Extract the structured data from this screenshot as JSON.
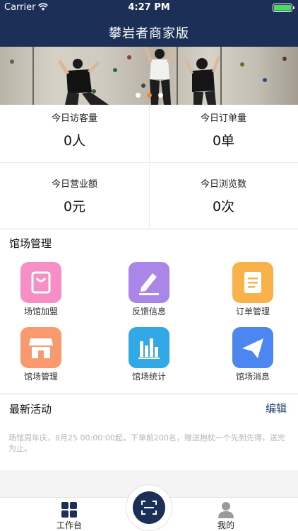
{
  "status_bar": {
    "carrier": "Carrier",
    "time": "4:27 PM"
  },
  "nav": {
    "title": "攀岩者商家版"
  },
  "banner": {
    "page_count": 3,
    "active_page": 2
  },
  "stats": {
    "visitors_label": "今日访客量",
    "visitors_value": "0人",
    "orders_label": "今日订单量",
    "orders_value": "0单",
    "revenue_label": "今日营业额",
    "revenue_value": "0元",
    "views_label": "今日浏览数",
    "views_value": "0次"
  },
  "venue_section": {
    "title": "馆场管理",
    "tiles": [
      {
        "label": "场馆加盟",
        "icon": "shopping-bag-icon",
        "color": "#f58fc6"
      },
      {
        "label": "反馈信息",
        "icon": "edit-pen-icon",
        "color": "#a986e8"
      },
      {
        "label": "订单管理",
        "icon": "document-icon",
        "color": "#f9b24a"
      },
      {
        "label": "馆场管理",
        "icon": "storefront-icon",
        "color": "#f99a6e"
      },
      {
        "label": "馆场统计",
        "icon": "bar-chart-icon",
        "color": "#33a8e6"
      },
      {
        "label": "馆场消息",
        "icon": "paper-plane-icon",
        "color": "#4d86f0"
      }
    ]
  },
  "activity": {
    "title": "最新活动",
    "edit_label": "编辑",
    "text": "场馆周年庆，8月25 00:00:00起，下单前200名，赠送抱枕一个先到先得，送完为止。"
  },
  "tabbar": {
    "workbench_label": "工作台",
    "mine_label": "我的",
    "accent": "#1c2f57"
  }
}
